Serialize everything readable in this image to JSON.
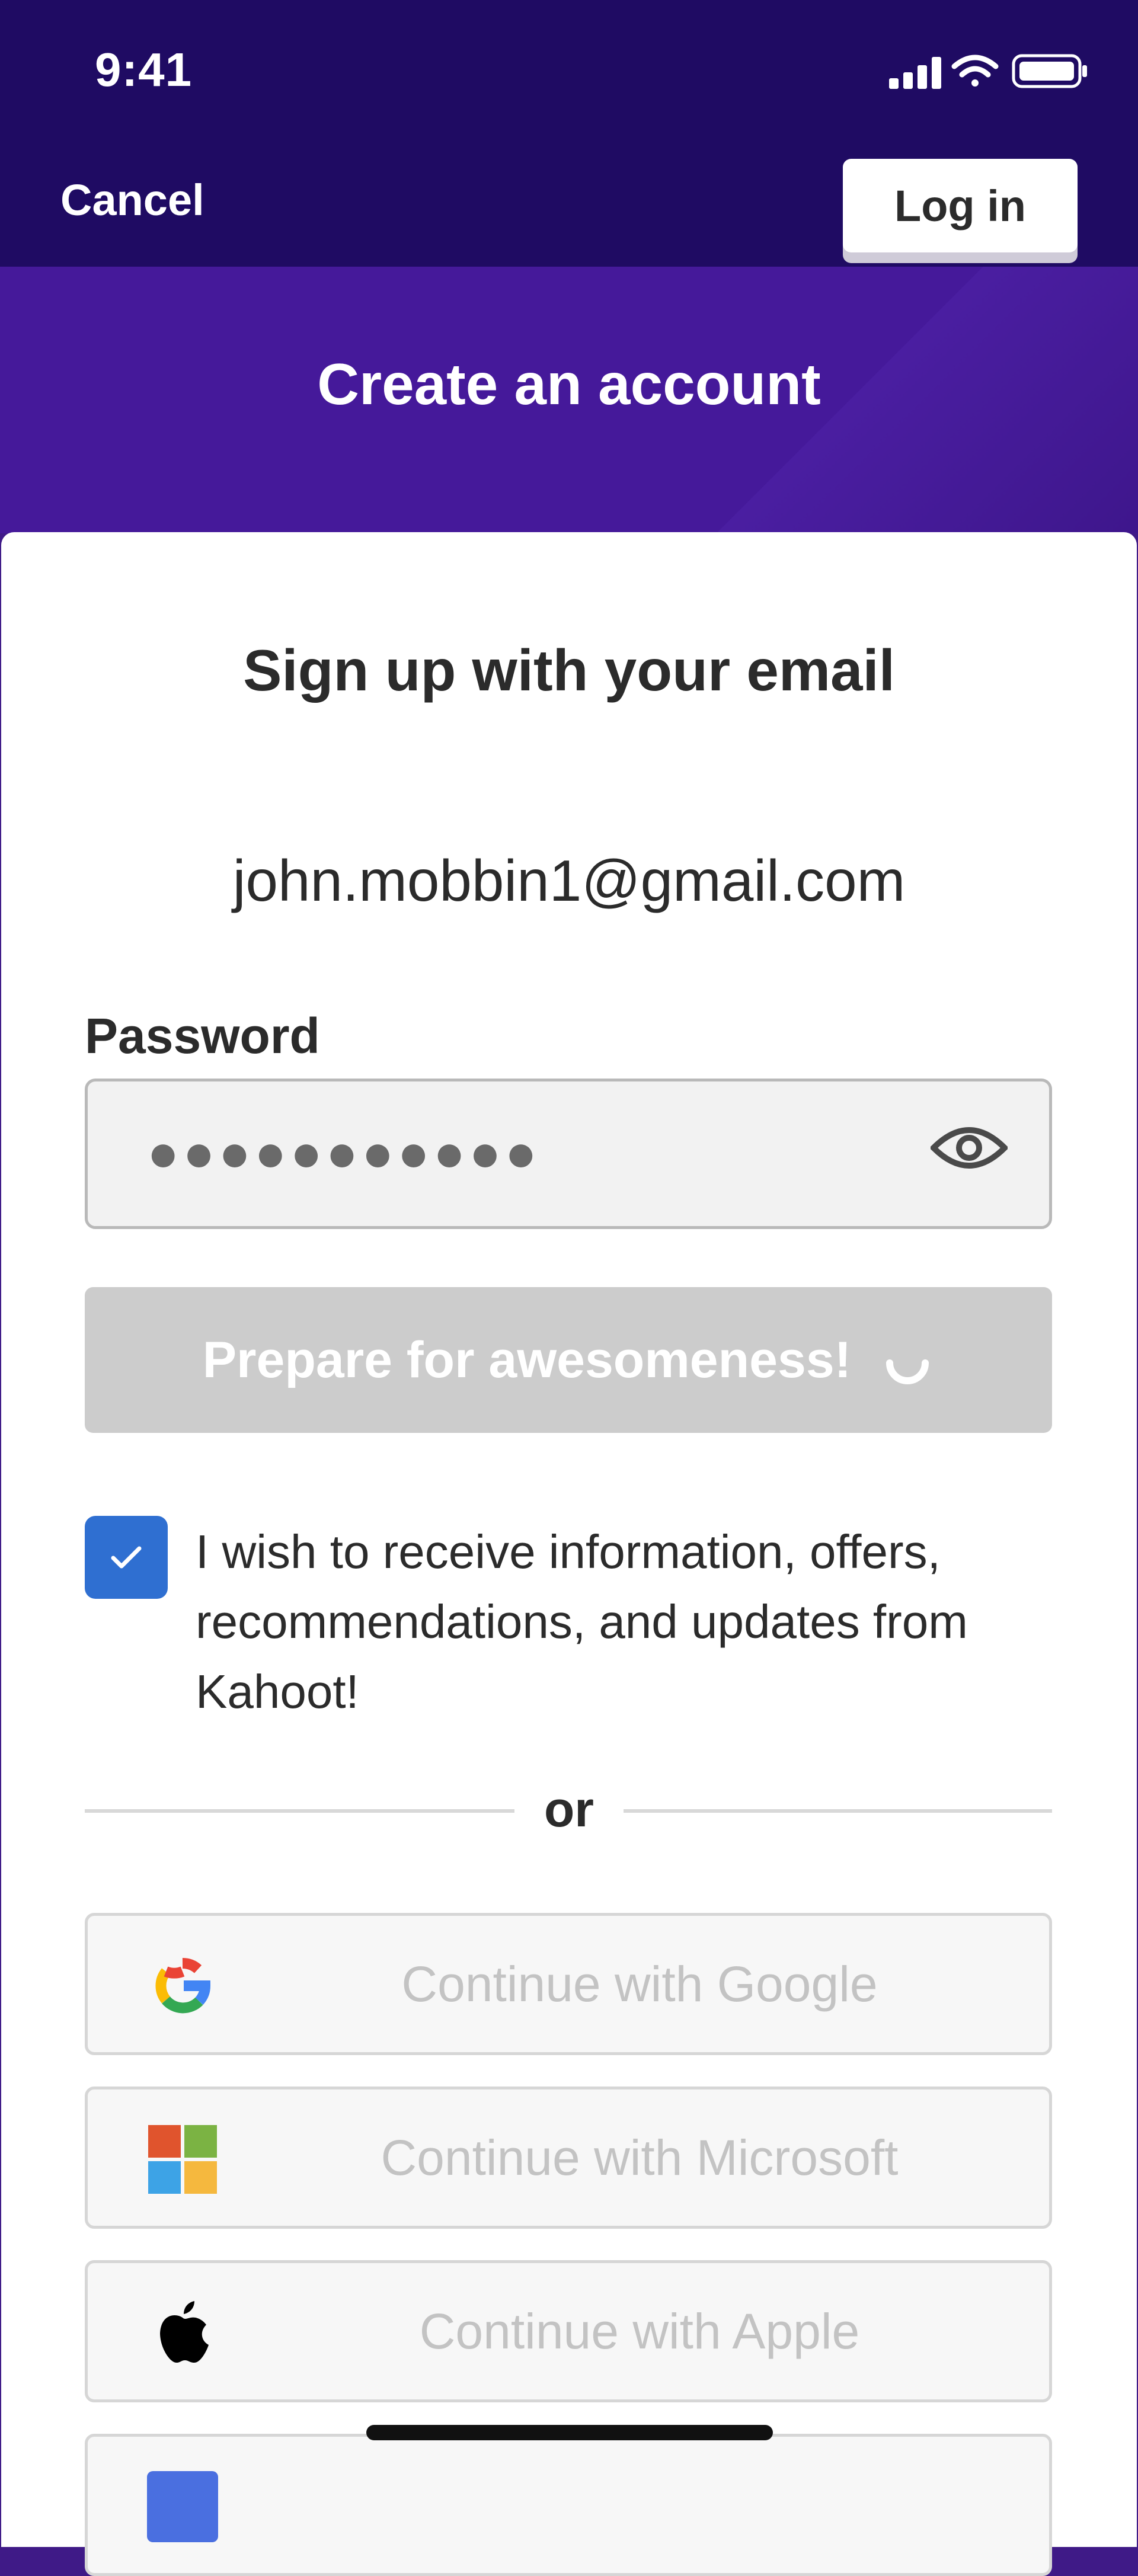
{
  "status_bar": {
    "time": "9:41"
  },
  "nav": {
    "cancel_label": "Cancel",
    "login_label": "Log in"
  },
  "hero": {
    "title": "Create an account"
  },
  "form": {
    "heading": "Sign up with your email",
    "email": "john.mobbin1@gmail.com",
    "password_label": "Password",
    "password_mask": "●●●●●●●●●●●",
    "submit_label": "Prepare for awesomeness!",
    "consent_text": "I wish to receive information, offers, recommendations, and updates from Kahoot!",
    "consent_checked": true
  },
  "divider": {
    "label": "or"
  },
  "social": {
    "google_label": "Continue with Google",
    "microsoft_label": "Continue with Microsoft",
    "apple_label": "Continue with Apple"
  },
  "colors": {
    "header_bg": "#1f0b63",
    "hero_bg": "#45199a",
    "checkbox": "#2f6fd1",
    "submit_disabled": "#cccccc"
  }
}
